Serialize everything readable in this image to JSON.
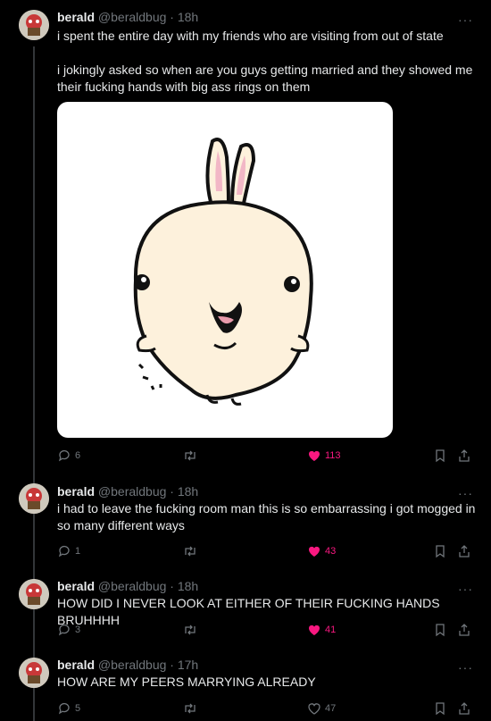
{
  "tweets": [
    {
      "name": "berald",
      "handle": "@beraldbug",
      "time": "· 18h",
      "text": "i spent the entire day with my friends who are visiting from out of state\n\ni jokingly asked so when are you guys getting married and they showed me their fucking hands with big ass rings on them",
      "replies": "6",
      "retweets": "",
      "likes": "113",
      "liked": true
    },
    {
      "name": "berald",
      "handle": "@beraldbug",
      "time": "· 18h",
      "text": "i had to leave the fucking room man this is so embarrassing i got mogged in so many different ways",
      "replies": "1",
      "retweets": "",
      "likes": "43",
      "liked": true
    },
    {
      "name": "berald",
      "handle": "@beraldbug",
      "time": "· 18h",
      "text": "HOW DID I NEVER LOOK AT EITHER OF THEIR FUCKING HANDS BRUHHHH",
      "replies": "3",
      "retweets": "",
      "likes": "41",
      "liked": true
    },
    {
      "name": "berald",
      "handle": "@beraldbug",
      "time": "· 17h",
      "text": "HOW ARE MY PEERS MARRYING ALREADY",
      "replies": "5",
      "retweets": "",
      "likes": "47",
      "liked": false
    }
  ],
  "more_glyph": "···",
  "colors": {
    "background": "#000000",
    "text": "#e7e9ea",
    "muted": "#71767b",
    "like": "#f91880"
  }
}
